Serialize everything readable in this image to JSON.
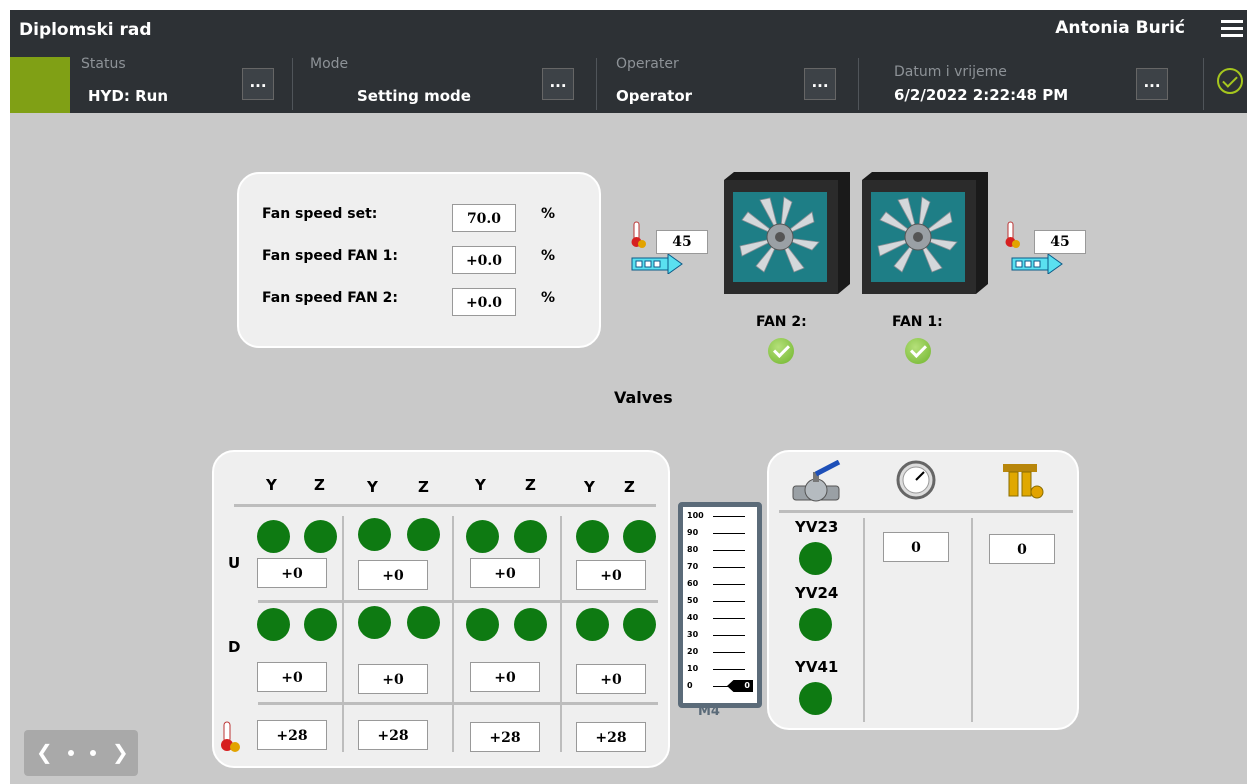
{
  "header": {
    "title": "Diplomski rad",
    "user": "Antonia Burić",
    "status": {
      "label": "Status",
      "value": "HYD: Run"
    },
    "mode": {
      "label": "Mode",
      "value": "Setting mode"
    },
    "operator": {
      "label": "Operater",
      "value": "Operator"
    },
    "datetime": {
      "label": "Datum i vrijeme",
      "value": "6/2/2022 2:22:48 PM"
    },
    "more_label": "..."
  },
  "fan_panel": {
    "set_label": "Fan speed set:",
    "set_value": "70.0",
    "fan1_label": "Fan speed FAN 1:",
    "fan1_value": "+0.0",
    "fan2_label": "Fan speed FAN 2:",
    "fan2_value": "+0.0",
    "unit": "%"
  },
  "temperatures": {
    "inlet": "45",
    "outlet": "45"
  },
  "fans": [
    {
      "label": "FAN 2:",
      "status": "ok"
    },
    {
      "label": "FAN 1:",
      "status": "ok"
    }
  ],
  "valves_title": "Valves",
  "valve_grid": {
    "column_headers": [
      "Y",
      "Z",
      "Y",
      "Z",
      "Y",
      "Z",
      "Y",
      "Z"
    ],
    "row_labels": [
      "U",
      "D"
    ],
    "u_values": [
      "+0",
      "+0",
      "+0",
      "+0"
    ],
    "d_values": [
      "+0",
      "+0",
      "+0",
      "+0"
    ],
    "temperature_values": [
      "+28",
      "+28",
      "+28",
      "+28"
    ]
  },
  "scale": {
    "ticks": [
      "100",
      "90",
      "80",
      "70",
      "60",
      "50",
      "40",
      "30",
      "20",
      "10",
      "0"
    ],
    "value": "0",
    "label": "M4"
  },
  "side_valves": {
    "items": [
      "YV23",
      "YV24",
      "YV41"
    ],
    "gauge_value": "0",
    "filter_value": "0"
  },
  "colors": {
    "active_green": "#0e7a12",
    "status_green": "#80a015"
  }
}
